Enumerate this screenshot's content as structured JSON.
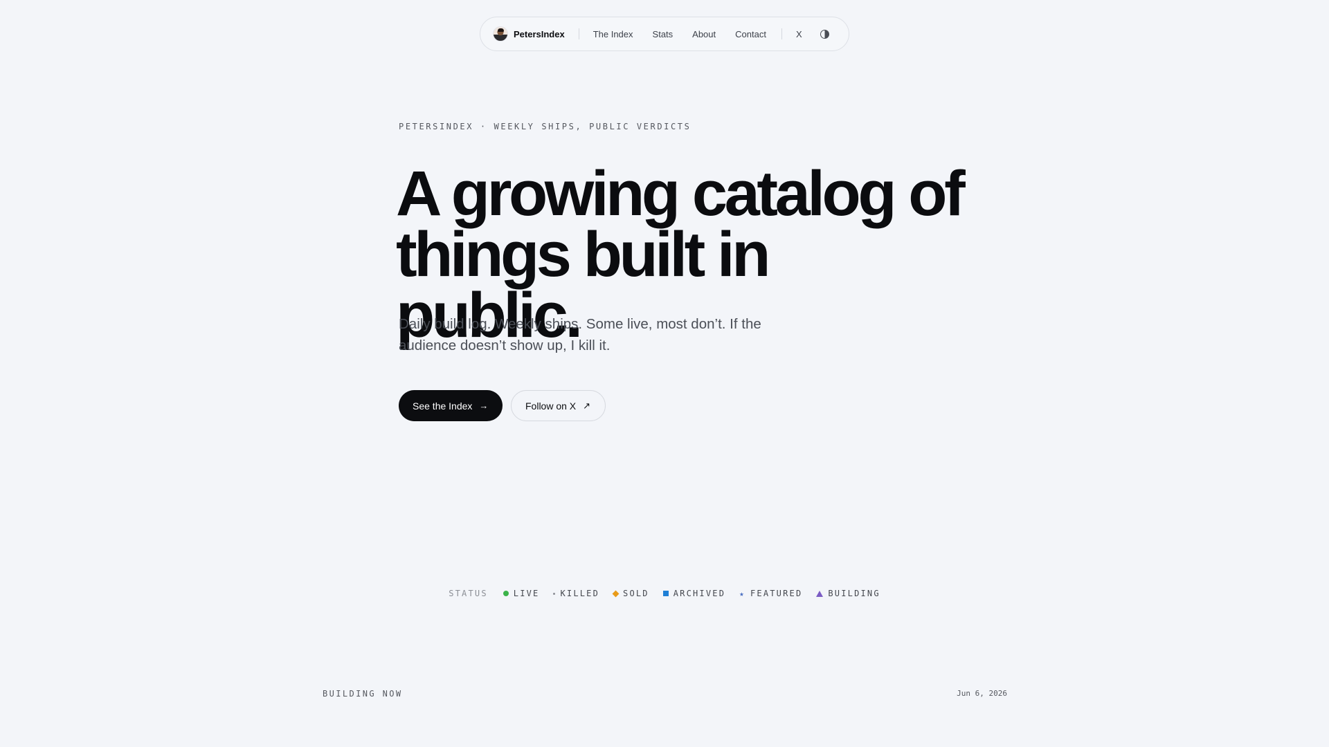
{
  "nav": {
    "brand_name": "PetersIndex",
    "links": [
      {
        "label": "The Index"
      },
      {
        "label": "Stats"
      },
      {
        "label": "About"
      },
      {
        "label": "Contact"
      }
    ],
    "x_label": "X",
    "theme_toggle_icon": "contrast-half-circle-icon"
  },
  "hero": {
    "eyebrow": "PETERSINDEX · WEEKLY SHIPS, PUBLIC VERDICTS",
    "headline_line1": "A growing catalog of",
    "headline_line2": "things built in public.",
    "lede": "Daily build log. Weekly ships. Some live, most don’t. If the audience doesn’t show up, I kill it.",
    "primary_cta": "See the Index",
    "primary_cta_icon": "→",
    "secondary_cta": "Follow on X",
    "secondary_cta_icon": "↗"
  },
  "status_legend": {
    "title": "STATUS",
    "items": [
      {
        "label": "LIVE",
        "icon": "green-dot",
        "color": "#3bb34a"
      },
      {
        "label": "KILLED",
        "icon": "small-dot",
        "color": "#8b8e95"
      },
      {
        "label": "SOLD",
        "icon": "diamond",
        "color": "#e89b1a"
      },
      {
        "label": "ARCHIVED",
        "icon": "square",
        "color": "#1f7fd6"
      },
      {
        "label": "FEATURED",
        "icon": "star",
        "color": "#4a6fc2"
      },
      {
        "label": "BUILDING",
        "icon": "triangle",
        "color": "#7b5cc4"
      }
    ]
  },
  "section": {
    "label": "BUILDING NOW",
    "date": "Jun 6, 2026"
  }
}
